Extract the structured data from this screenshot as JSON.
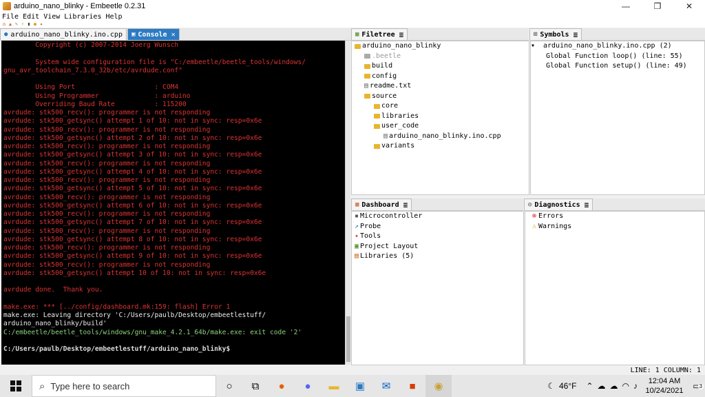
{
  "window": {
    "title": "arduino_nano_blinky - Embeetle 0.2.31",
    "min": "—",
    "max": "❐",
    "close": "✕"
  },
  "menu": [
    "File",
    "Edit",
    "View",
    "Libraries",
    "Help"
  ],
  "tabs": {
    "editor": "arduino_nano_blinky.ino.cpp",
    "console": "Console"
  },
  "console_lines": [
    {
      "c": "r",
      "t": "        Copyright (c) 2007-2014 Joerg Wunsch"
    },
    {
      "c": "r",
      "t": ""
    },
    {
      "c": "r",
      "t": "        System wide configuration file is \"C:/embeetle/beetle_tools/windows/"
    },
    {
      "c": "r",
      "t": "gnu_avr_toolchain_7.3.0_32b/etc/avrdude.conf\""
    },
    {
      "c": "r",
      "t": ""
    },
    {
      "c": "r",
      "t": "        Using Port                    : COM4"
    },
    {
      "c": "r",
      "t": "        Using Programmer              : arduino"
    },
    {
      "c": "r",
      "t": "        Overriding Baud Rate          : 115200"
    },
    {
      "c": "r",
      "t": "avrdude: stk500_recv(): programmer is not responding"
    },
    {
      "c": "r",
      "t": "avrdude: stk500_getsync() attempt 1 of 10: not in sync: resp=0x6e"
    },
    {
      "c": "r",
      "t": "avrdude: stk500_recv(): programmer is not responding"
    },
    {
      "c": "r",
      "t": "avrdude: stk500_getsync() attempt 2 of 10: not in sync: resp=0x6e"
    },
    {
      "c": "r",
      "t": "avrdude: stk500_recv(): programmer is not responding"
    },
    {
      "c": "r",
      "t": "avrdude: stk500_getsync() attempt 3 of 10: not in sync: resp=0x6e"
    },
    {
      "c": "r",
      "t": "avrdude: stk500_recv(): programmer is not responding"
    },
    {
      "c": "r",
      "t": "avrdude: stk500_getsync() attempt 4 of 10: not in sync: resp=0x6e"
    },
    {
      "c": "r",
      "t": "avrdude: stk500_recv(): programmer is not responding"
    },
    {
      "c": "r",
      "t": "avrdude: stk500_getsync() attempt 5 of 10: not in sync: resp=0x6e"
    },
    {
      "c": "r",
      "t": "avrdude: stk500_recv(): programmer is not responding"
    },
    {
      "c": "r",
      "t": "avrdude: stk500_getsync() attempt 6 of 10: not in sync: resp=0x6e"
    },
    {
      "c": "r",
      "t": "avrdude: stk500_recv(): programmer is not responding"
    },
    {
      "c": "r",
      "t": "avrdude: stk500_getsync() attempt 7 of 10: not in sync: resp=0x6e"
    },
    {
      "c": "r",
      "t": "avrdude: stk500_recv(): programmer is not responding"
    },
    {
      "c": "r",
      "t": "avrdude: stk500_getsync() attempt 8 of 10: not in sync: resp=0x6e"
    },
    {
      "c": "r",
      "t": "avrdude: stk500_recv(): programmer is not responding"
    },
    {
      "c": "r",
      "t": "avrdude: stk500_getsync() attempt 9 of 10: not in sync: resp=0x6e"
    },
    {
      "c": "r",
      "t": "avrdude: stk500_recv(): programmer is not responding"
    },
    {
      "c": "r",
      "t": "avrdude: stk500_getsync() attempt 10 of 10: not in sync: resp=0x6e"
    },
    {
      "c": "r",
      "t": ""
    },
    {
      "c": "r",
      "t": "avrdude done.  Thank you."
    },
    {
      "c": "r",
      "t": ""
    },
    {
      "c": "r",
      "t": "make.exe: *** [../config/dashboard.mk:159: flash] Error 1"
    },
    {
      "c": "w",
      "t": "make.exe: Leaving directory 'C:/Users/paulb/Desktop/embeetlestuff/"
    },
    {
      "c": "w",
      "t": "arduino_nano_blinky/build'"
    },
    {
      "c": "g",
      "t": "C:/embeetle/beetle_tools/windows/gnu_make_4.2.1_64b/make.exe: exit code '2'"
    },
    {
      "c": "r",
      "t": ""
    },
    {
      "c": "b",
      "t": "C:/Users/paulb/Desktop/embeetlestuff/arduino_nano_blinky$"
    }
  ],
  "filetree": {
    "tab": "Filetree",
    "items": [
      {
        "label": "arduino_nano_blinky",
        "indent": 0,
        "folder": true
      },
      {
        "label": ".beetle",
        "indent": 1,
        "folder": true,
        "muted": true
      },
      {
        "label": "build",
        "indent": 1,
        "folder": true
      },
      {
        "label": "config",
        "indent": 1,
        "folder": true
      },
      {
        "label": "readme.txt",
        "indent": 1,
        "folder": false
      },
      {
        "label": "source",
        "indent": 1,
        "folder": true
      },
      {
        "label": "core",
        "indent": 2,
        "folder": true
      },
      {
        "label": "libraries",
        "indent": 2,
        "folder": true
      },
      {
        "label": "user_code",
        "indent": 2,
        "folder": true
      },
      {
        "label": "arduino_nano_blinky.ino.cpp",
        "indent": 3,
        "folder": false
      },
      {
        "label": "variants",
        "indent": 2,
        "folder": true
      }
    ]
  },
  "symbols": {
    "tab": "Symbols",
    "items": [
      "arduino_nano_blinky.ino.cpp (2)",
      "Global Function loop() (line: 55)",
      "Global Function setup() (line: 49)"
    ]
  },
  "dashboard": {
    "tab": "Dashboard",
    "items": [
      "Microcontroller",
      "Probe",
      "Tools",
      "Project Layout",
      "Libraries (5)"
    ]
  },
  "diagnostics": {
    "tab": "Diagnostics",
    "items": [
      "Errors",
      "Warnings"
    ]
  },
  "status": "LINE: 1 COLUMN: 1",
  "taskbar": {
    "search_placeholder": "Type here to search",
    "weather": "46°F",
    "time": "12:04 AM",
    "date": "10/24/2021",
    "badge": "3"
  }
}
